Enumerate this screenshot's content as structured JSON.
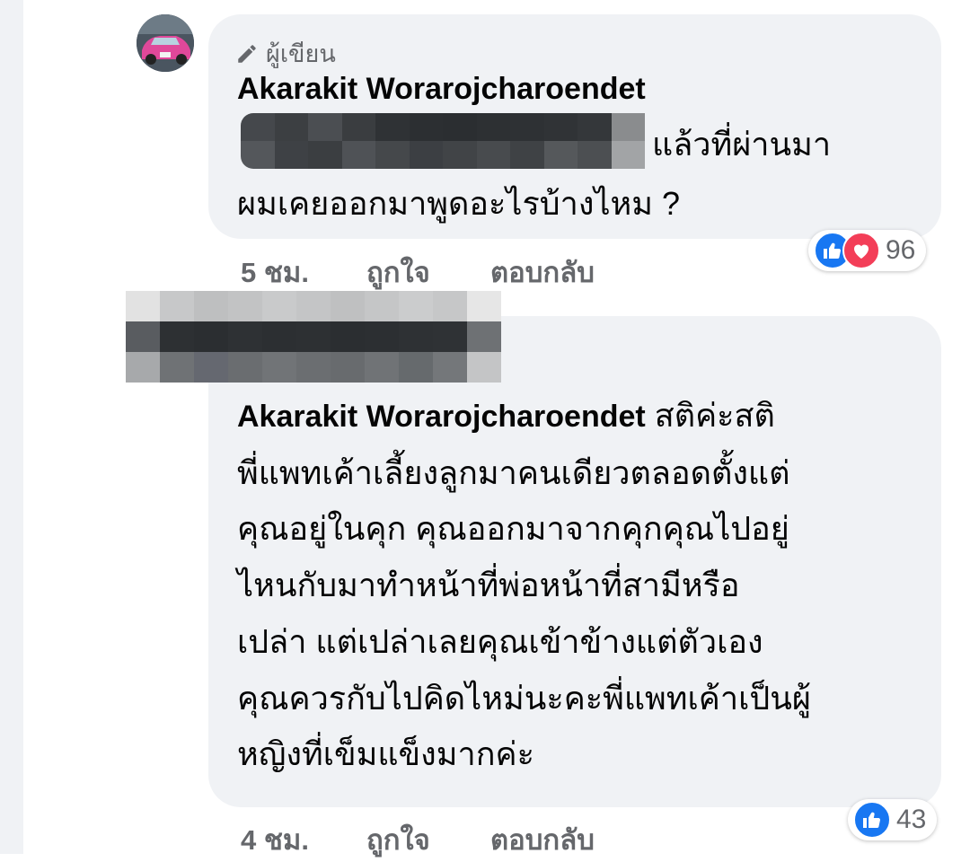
{
  "comment1": {
    "author_badge": "ผู้เขียน",
    "author_name": "Akarakit Worarojcharoendet",
    "text_line1": "แล้วที่ผ่านมา",
    "text_line2": "ผมเคยออกมาพูดอะไรบ้างไหม ?",
    "time": "5 ชม.",
    "like_label": "ถูกใจ",
    "reply_label": "ตอบกลับ",
    "reactions": {
      "icons": [
        "like-icon",
        "love-icon"
      ],
      "count": "96"
    }
  },
  "comment2": {
    "mention": "Akarakit Worarojcharoendet",
    "lines": [
      "สติค่ะสติ",
      "พี่แพทเค้าเลี้ยงลูกมาคนเดียวตลอดตั้งแต่",
      "คุณอยู่ในคุก คุณออกมาจากคุกคุณไปอยู่",
      "ไหนกับมาทำหน้าที่พ่อหน้าที่สามีหรือ",
      "เปล่า แต่เปล่าเลยคุณเข้าข้างแต่ตัวเอง",
      "คุณควรกับไปคิดไหม่นะคะพี่แพทเค้าเป็นผู้",
      "หญิงที่เข็มแข็งมากค่ะ"
    ],
    "time": "4 ชม.",
    "like_label": "ถูกใจ",
    "reply_label": "ตอบกลับ",
    "reactions": {
      "icons": [
        "like-icon"
      ],
      "count": "43"
    }
  },
  "colors": {
    "bubble": "#f0f2f5",
    "meta_text": "#65676b",
    "like_blue": "#1877f2",
    "love_red": "#f33e58"
  }
}
